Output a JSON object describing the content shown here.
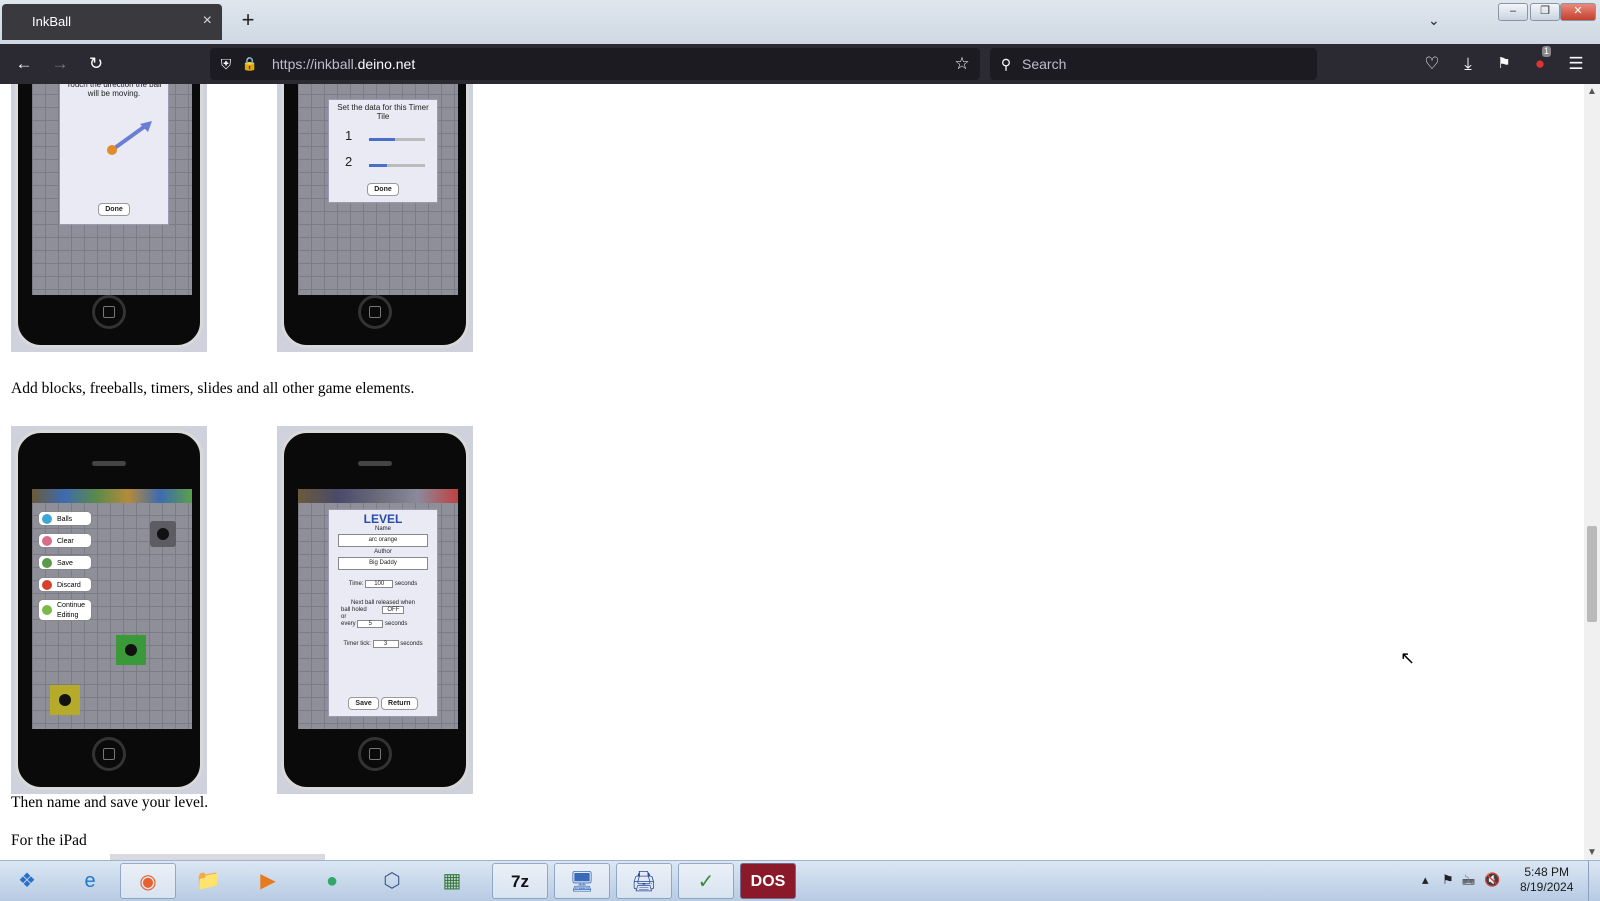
{
  "browser": {
    "tab_title": "InkBall",
    "tab_close": "×",
    "new_tab": "+",
    "url_prefix": "https://inkball.",
    "url_domain": "deino.net",
    "search_placeholder": "Search",
    "extension_badge": "1",
    "accent_color": "#2b2a33"
  },
  "content": {
    "phone1": {
      "dialog_text": "Touch the direction the ball will be moving.",
      "done_label": "Done"
    },
    "phone2": {
      "dialog_title": "Set the data for this Timer Tile",
      "row1_num": "1",
      "row2_num": "2",
      "done_label": "Done"
    },
    "caption1": "Add blocks, freeballs, timers, slides and all other game elements.",
    "phone3": {
      "menu": [
        "Balls",
        "Clear",
        "Save",
        "Discard",
        "Continue Editing"
      ]
    },
    "phone4": {
      "title": "LEVEL",
      "name_label": "Name",
      "name_value": "arc orange",
      "author_label": "Author",
      "author_value": "Big Daddy",
      "time_label": "Time:",
      "time_value": "100",
      "seconds": "seconds",
      "next_ball": "Next ball released when",
      "ball_holed": "ball holed",
      "off": "OFF",
      "or": "or",
      "every": "every",
      "every_value": "5",
      "timer_tick": "Timer tick:",
      "tick_value": "3",
      "save": "Save",
      "return": "Return"
    },
    "caption2": "Then name and save your level.",
    "caption3": "For the iPad"
  },
  "taskbar": {
    "time": "5:48 PM",
    "date": "8/19/2024",
    "dos_label": "DOS",
    "zip_label": "7z"
  }
}
